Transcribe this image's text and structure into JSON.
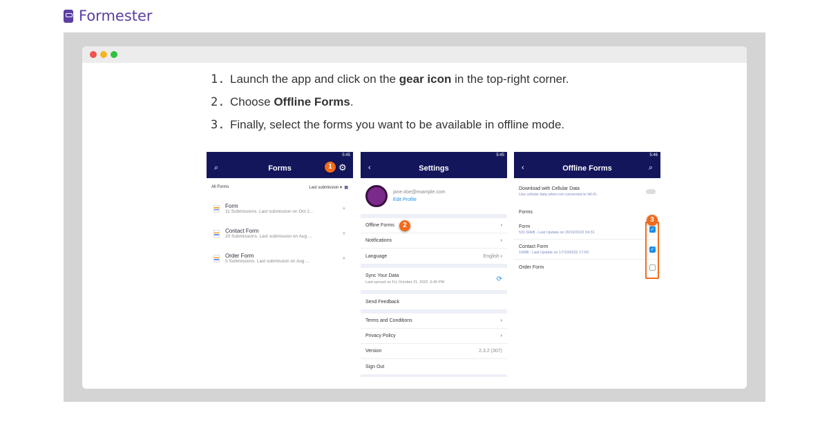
{
  "brand": {
    "name": "Formester",
    "color": "#5b3fa0"
  },
  "steps": [
    {
      "num": "1.",
      "pre": "Launch the app and click on the ",
      "bold": "gear icon",
      "post": " in the top-right corner."
    },
    {
      "num": "2.",
      "pre": "Choose ",
      "bold": "Offline Forms",
      "post": "."
    },
    {
      "num": "3.",
      "pre": "Finally, select the forms you want to be available in offline mode.",
      "bold": "",
      "post": ""
    }
  ],
  "screen1": {
    "time": "5:45",
    "title": "Forms",
    "badge": "1",
    "filter": "All Forms",
    "sort": "Last submission",
    "forms": [
      {
        "name": "Form",
        "meta": "11 Submissions. Last submission on Oct 2..."
      },
      {
        "name": "Contact Form",
        "meta": "20 Submissions. Last submission on Aug ..."
      },
      {
        "name": "Order Form",
        "meta": "5 Submissions. Last submission on Aug ..."
      }
    ]
  },
  "screen2": {
    "time": "5:45",
    "title": "Settings",
    "email": "jane.doe@example.com",
    "edit_profile": "Edit Profile",
    "badge": "2",
    "offline": "Offline Forms",
    "notifications": "Notifications",
    "language": "Language",
    "language_value": "English",
    "sync": "Sync Your Data",
    "sync_sub": "Last synced on Fri, October 21, 2022, 5:45 PM",
    "feedback": "Send Feedback",
    "terms": "Terms and Conditions",
    "privacy": "Privacy Policy",
    "version": "Version",
    "version_value": "2.3.2 (307)",
    "signout": "Sign Out"
  },
  "screen3": {
    "time": "5:46",
    "title": "Offline Forms",
    "cellular": "Download with Cellular Data",
    "cellular_sub": "Use cellular data when not connected to Wi-Fi.",
    "cellular_on": false,
    "forms_label": "Forms",
    "badge": "3",
    "forms": [
      {
        "name": "Form",
        "meta": "531.60kB - Last Update on 20/10/2022 04:31",
        "checked": true
      },
      {
        "name": "Contact Form",
        "meta": "10MB - Last Update on 17/10/2022 17:50",
        "checked": true
      },
      {
        "name": "Order Form",
        "meta": "",
        "checked": false
      }
    ]
  },
  "colors": {
    "header": "#14165c",
    "badge": "#f26a1b",
    "accent": "#1a8fe8"
  }
}
